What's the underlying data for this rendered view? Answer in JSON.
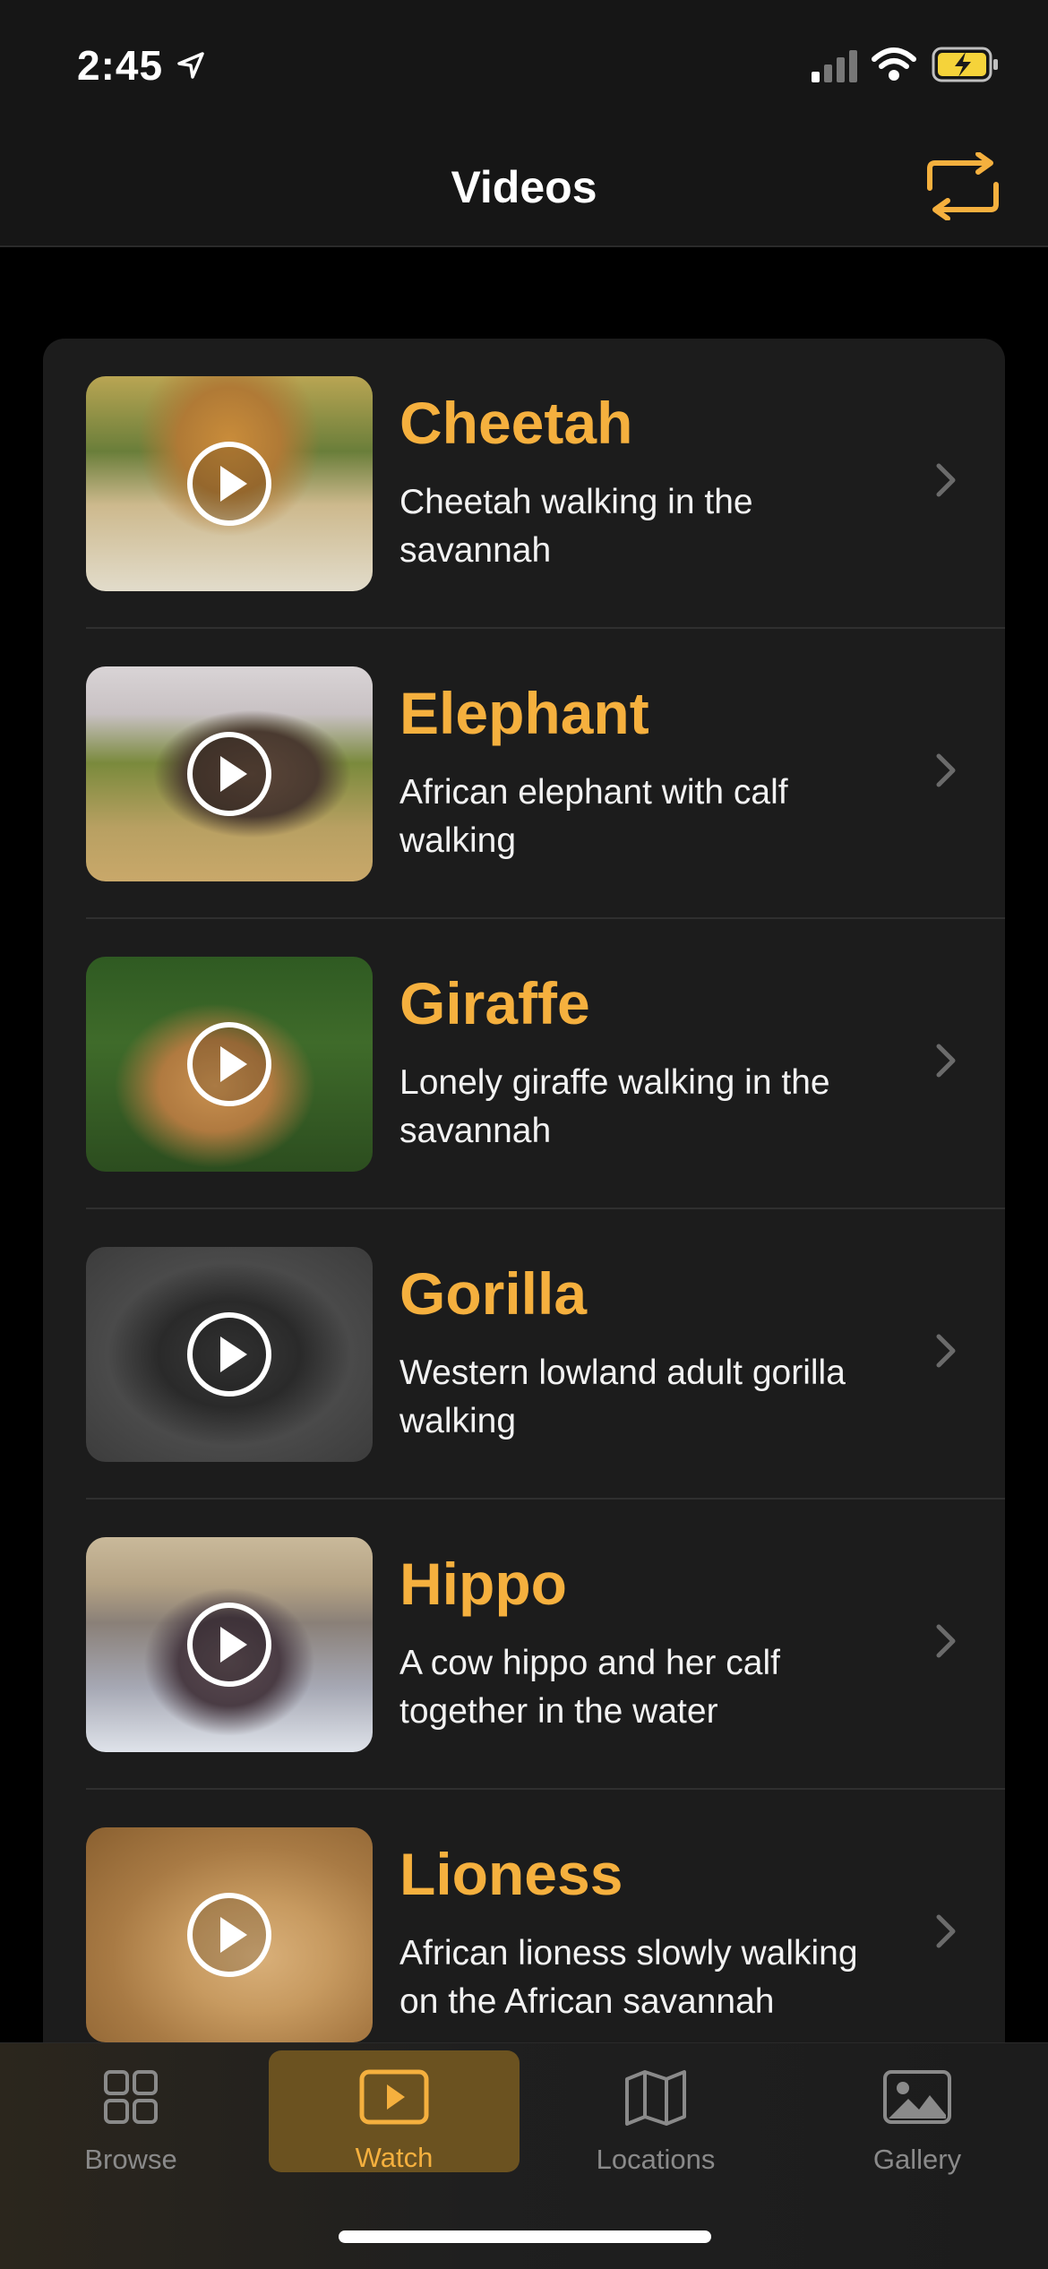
{
  "status_bar": {
    "time": "2:45"
  },
  "nav": {
    "title": "Videos",
    "action_icon": "sync-arrows-icon"
  },
  "colors": {
    "accent": "#f5b03e",
    "background": "#000000",
    "card": "#1c1c1c"
  },
  "videos": [
    {
      "title": "Cheetah",
      "description": "Cheetah walking in the savannah"
    },
    {
      "title": "Elephant",
      "description": "African elephant with calf walking"
    },
    {
      "title": "Giraffe",
      "description": "Lonely giraffe walking in the savannah"
    },
    {
      "title": "Gorilla",
      "description": "Western lowland adult gorilla walking"
    },
    {
      "title": "Hippo",
      "description": "A cow hippo and her calf together in the water"
    },
    {
      "title": "Lioness",
      "description": "African lioness slowly walking on the African savannah"
    }
  ],
  "tabs": [
    {
      "label": "Browse",
      "icon": "grid-icon",
      "active": false
    },
    {
      "label": "Watch",
      "icon": "play-rectangle-icon",
      "active": true
    },
    {
      "label": "Locations",
      "icon": "map-icon",
      "active": false
    },
    {
      "label": "Gallery",
      "icon": "photo-icon",
      "active": false
    }
  ]
}
